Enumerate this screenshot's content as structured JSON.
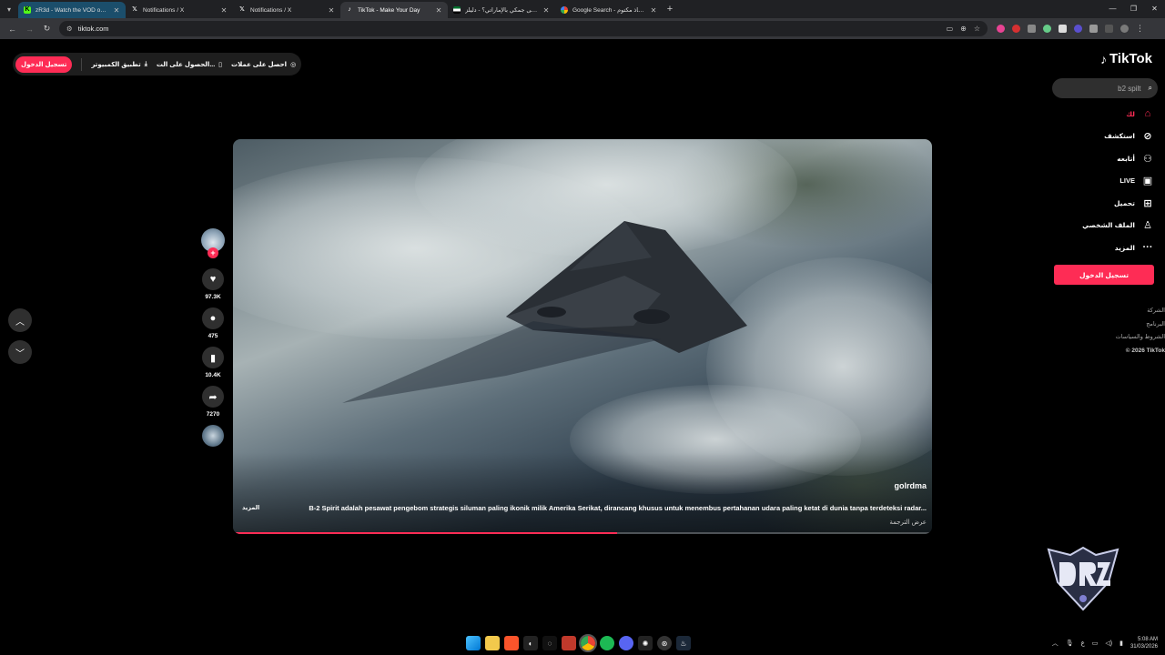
{
  "browser": {
    "tabs": [
      {
        "title": "zR3d - Watch the VOD on Kick",
        "favicon": "kick-icon",
        "active": false
      },
      {
        "title": "Notifications / X",
        "favicon": "x-icon",
        "active": false
      },
      {
        "title": "Notifications / X",
        "favicon": "x-icon",
        "active": false
      },
      {
        "title": "TikTok - Make Your Day",
        "favicon": "tiktok-icon",
        "active": true
      },
      {
        "title": "ما معنى جمكي بالإماراتي؟ - دليلز",
        "favicon": "site-icon",
        "active": false
      },
      {
        "title": "Google Search - استاذ مكتوم",
        "favicon": "google-icon",
        "active": false
      }
    ],
    "url": "tiktok.com"
  },
  "topbar": {
    "login": "تسجيل الدخول",
    "pc_app": "تطبيق الكمبيوتر",
    "get_on": "الحصول على الت...",
    "coins": "احصل على عملات"
  },
  "sidebar": {
    "logo": "TikTok",
    "search_value": "b2 spilt",
    "items": [
      {
        "label": "لك",
        "icon": "home-icon"
      },
      {
        "label": "استكشف",
        "icon": "compass-icon"
      },
      {
        "label": "أتابعه",
        "icon": "following-icon"
      },
      {
        "label": "LIVE",
        "icon": "live-icon"
      },
      {
        "label": "تحميل",
        "icon": "upload-icon"
      },
      {
        "label": "الملف الشخصي",
        "icon": "profile-icon"
      },
      {
        "label": "المزيد",
        "icon": "more-icon"
      }
    ],
    "login_button": "تسجيل الدخول",
    "footer": [
      "الشركة",
      "البرنامج",
      "الشروط والسياسات",
      "© 2026 TikTok"
    ]
  },
  "video": {
    "author": "golrdma",
    "caption": "B-2 Spirit adalah pesawat pengebom strategis siluman paling ikonik milik Amerika Serikat, dirancang khusus untuk menembus pertahanan udara paling ketat di dunia tanpa terdeteksi radar...",
    "more": "المزيد",
    "translate": "عرض الترجمة",
    "progress": 0.55
  },
  "actions": {
    "likes": "97.3K",
    "comments": "475",
    "saves": "10.4K",
    "shares": "7270"
  },
  "taskbar": {
    "time": "5:08 AM",
    "date": "31/03/2026",
    "lang": "ع"
  },
  "colors": {
    "accent": "#fe2c55",
    "background": "#000000"
  }
}
